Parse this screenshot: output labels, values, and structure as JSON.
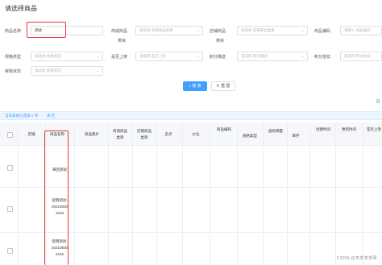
{
  "page_title": "请选择商品",
  "filters": {
    "product_name_label": "商品名称",
    "product_name_value": "测试",
    "mall_category_label_1": "商城商品",
    "mall_category_label_2": "类目",
    "mall_category_placeholder": "请选择 商城商品类目",
    "store_category_label_1": "店铺商品",
    "store_category_label_2": "类目",
    "store_category_placeholder": "请选择 店铺商品类目",
    "product_code_label": "商品编码",
    "product_code_placeholder": "请输入 商品编码",
    "spec_type_label": "规格类型",
    "spec_type_placeholder": "请选择 规格类型",
    "on_shelf_label": "是否上架",
    "on_shelf_placeholder": "请选择 是否上架",
    "points_exchange_label": "积分赚送",
    "points_exchange_placeholder": "请选择 积分赚送",
    "points_type_label": "积分抵扣",
    "points_type_placeholder": "请选择 积分抵扣",
    "audit_status_label": "审核状态",
    "audit_status_placeholder": "请选择 审核状态"
  },
  "actions": {
    "search_label": "搜 索",
    "reset_label": "重 置"
  },
  "selection_bar": {
    "text": "当前表格已选择 0 项",
    "clear_label": "清 空"
  },
  "table": {
    "columns": {
      "store": "店铺",
      "product_name": "商品名称",
      "product_image": "商品图片",
      "mall_category_1": "商城商品",
      "mall_category_2": "类目",
      "store_category_1": "店铺商品",
      "store_category_2": "类目",
      "selling_point": "卖点",
      "price": "价位",
      "product_code_1": "商品编码",
      "product_code_2": "",
      "spec_type": "规格类型",
      "virtual_sales_1": "虚拟销量",
      "virtual_sales_2": "",
      "stock": "库存",
      "created_1": "创建时间",
      "created_2": "",
      "updated_1": "更新时间",
      "updated_2": "",
      "on_shelf_1": "是否上架",
      "on_shelf_2": ""
    },
    "rows": [
      {
        "name_lines": [
          "来回测试"
        ]
      },
      {
        "name_lines": [
          "促销测试-",
          "20210830",
          "2216"
        ]
      },
      {
        "name_lines": [
          "促销测试-",
          "20210830",
          "2216"
        ]
      }
    ]
  },
  "watermark": "CSDN @本本本求哥",
  "colors": {
    "primary": "#409eff",
    "highlight": "#e53935"
  }
}
